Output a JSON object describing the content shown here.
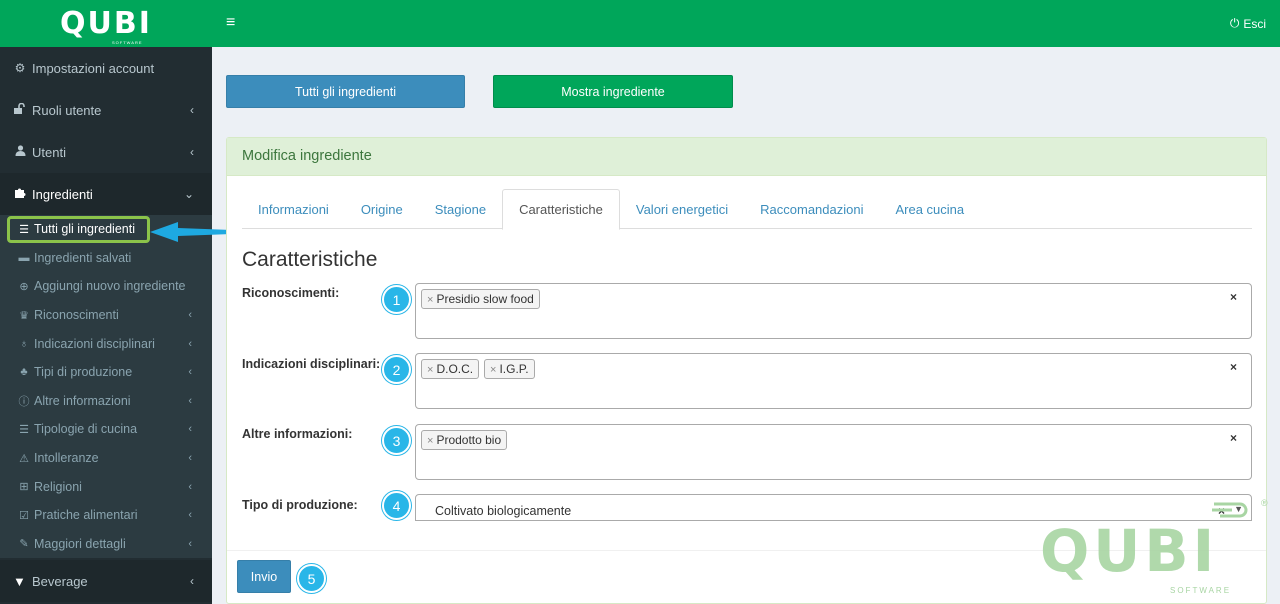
{
  "brand": {
    "name": "QUBI",
    "sub": "SOFTWARE",
    "accent": "#00a65a"
  },
  "header": {
    "logout_label": "Esci"
  },
  "sidebar": {
    "items": [
      {
        "label": "Impostazioni account",
        "icon": "gear-icon"
      },
      {
        "label": "Ruoli utente",
        "icon": "unlock-icon"
      },
      {
        "label": "Utenti",
        "icon": "user-icon"
      },
      {
        "label": "Ingredienti",
        "icon": "puzzle-icon"
      }
    ],
    "submenu": [
      {
        "label": "Tutti gli ingredienti",
        "icon": "list-icon"
      },
      {
        "label": "Ingredienti salvati",
        "icon": "archive-icon"
      },
      {
        "label": "Aggiungi nuovo ingrediente",
        "icon": "plus-circle-icon"
      },
      {
        "label": "Riconoscimenti",
        "icon": "trophy-icon"
      },
      {
        "label": "Indicazioni disciplinari",
        "icon": "lightbulb-icon"
      },
      {
        "label": "Tipi di produzione",
        "icon": "plant-icon"
      },
      {
        "label": "Altre informazioni",
        "icon": "info-icon"
      },
      {
        "label": "Tipologie di cucina",
        "icon": "list-icon"
      },
      {
        "label": "Intolleranze",
        "icon": "warning-icon"
      },
      {
        "label": "Religioni",
        "icon": "plus-square-icon"
      },
      {
        "label": "Pratiche alimentari",
        "icon": "check-square-icon"
      },
      {
        "label": "Maggiori dettagli",
        "icon": "wrench-icon"
      }
    ],
    "bottom": {
      "label": "Beverage",
      "icon": "filter-icon"
    }
  },
  "toolbar": {
    "all_label": "Tutti gli ingredienti",
    "show_label": "Mostra ingrediente"
  },
  "panel": {
    "heading": "Modifica ingrediente"
  },
  "tabs": [
    "Informazioni",
    "Origine",
    "Stagione",
    "Caratteristiche",
    "Valori energetici",
    "Raccomandazioni",
    "Area cucina"
  ],
  "section": {
    "title": "Caratteristiche"
  },
  "form": {
    "riconoscimenti": {
      "label": "Riconoscimenti:",
      "tags": [
        "Presidio slow food"
      ],
      "badge": "1"
    },
    "indicazioni": {
      "label": "Indicazioni disciplinari:",
      "tags": [
        "D.O.C.",
        "I.G.P."
      ],
      "badge": "2"
    },
    "altre": {
      "label": "Altre informazioni:",
      "tags": [
        "Prodotto bio"
      ],
      "badge": "3"
    },
    "tipo": {
      "label": "Tipo di produzione:",
      "value": "Coltivato biologicamente",
      "badge": "4"
    },
    "remove_symbol": "×",
    "submit_label": "Invio",
    "submit_badge": "5"
  },
  "watermark": {
    "name": "QUBI",
    "sub": "SOFTWARE",
    "mark": "®"
  }
}
